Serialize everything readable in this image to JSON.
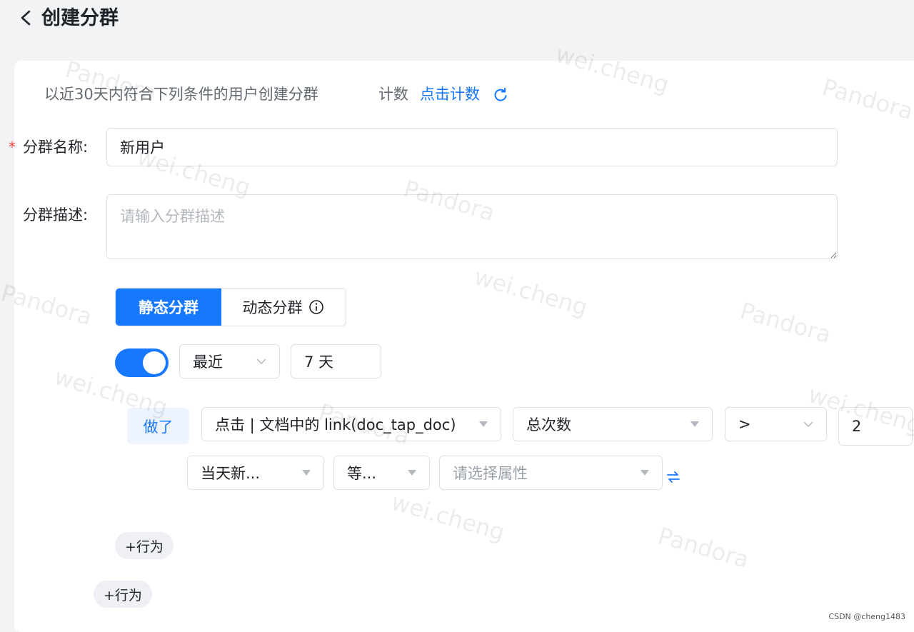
{
  "header": {
    "title": "创建分群"
  },
  "intro": {
    "subtitle": "以近30天内符合下列条件的用户创建分群",
    "count_label": "计数",
    "count_link": "点击计数"
  },
  "form": {
    "required_mark": "*",
    "name_label": "分群名称:",
    "name_value": "新用户",
    "desc_label": "分群描述:",
    "desc_placeholder": "请输入分群描述"
  },
  "segment_type": {
    "static_label": "静态分群",
    "dynamic_label": "动态分群",
    "selected": "静态分群"
  },
  "time_range": {
    "toggle_on": true,
    "mode": "最近",
    "days_value": "7 天"
  },
  "condition": {
    "did_label": "做了",
    "event": "点击 | 文档中的 link(doc_tap_doc)",
    "metric": "总次数",
    "operator": ">",
    "value": "2",
    "filter_property": "当天新...",
    "filter_operator": "等...",
    "filter_value_placeholder": "请选择属性"
  },
  "actions": {
    "add_behavior_inner": "+行为",
    "add_behavior_outer": "+行为"
  },
  "watermarks": [
    "Pandora",
    "wei.cheng"
  ],
  "footer": {
    "credit": "CSDN @cheng1483"
  },
  "colors": {
    "accent": "#1677ff",
    "required": "#f54a45",
    "tag_bg": "#edf3ff"
  }
}
